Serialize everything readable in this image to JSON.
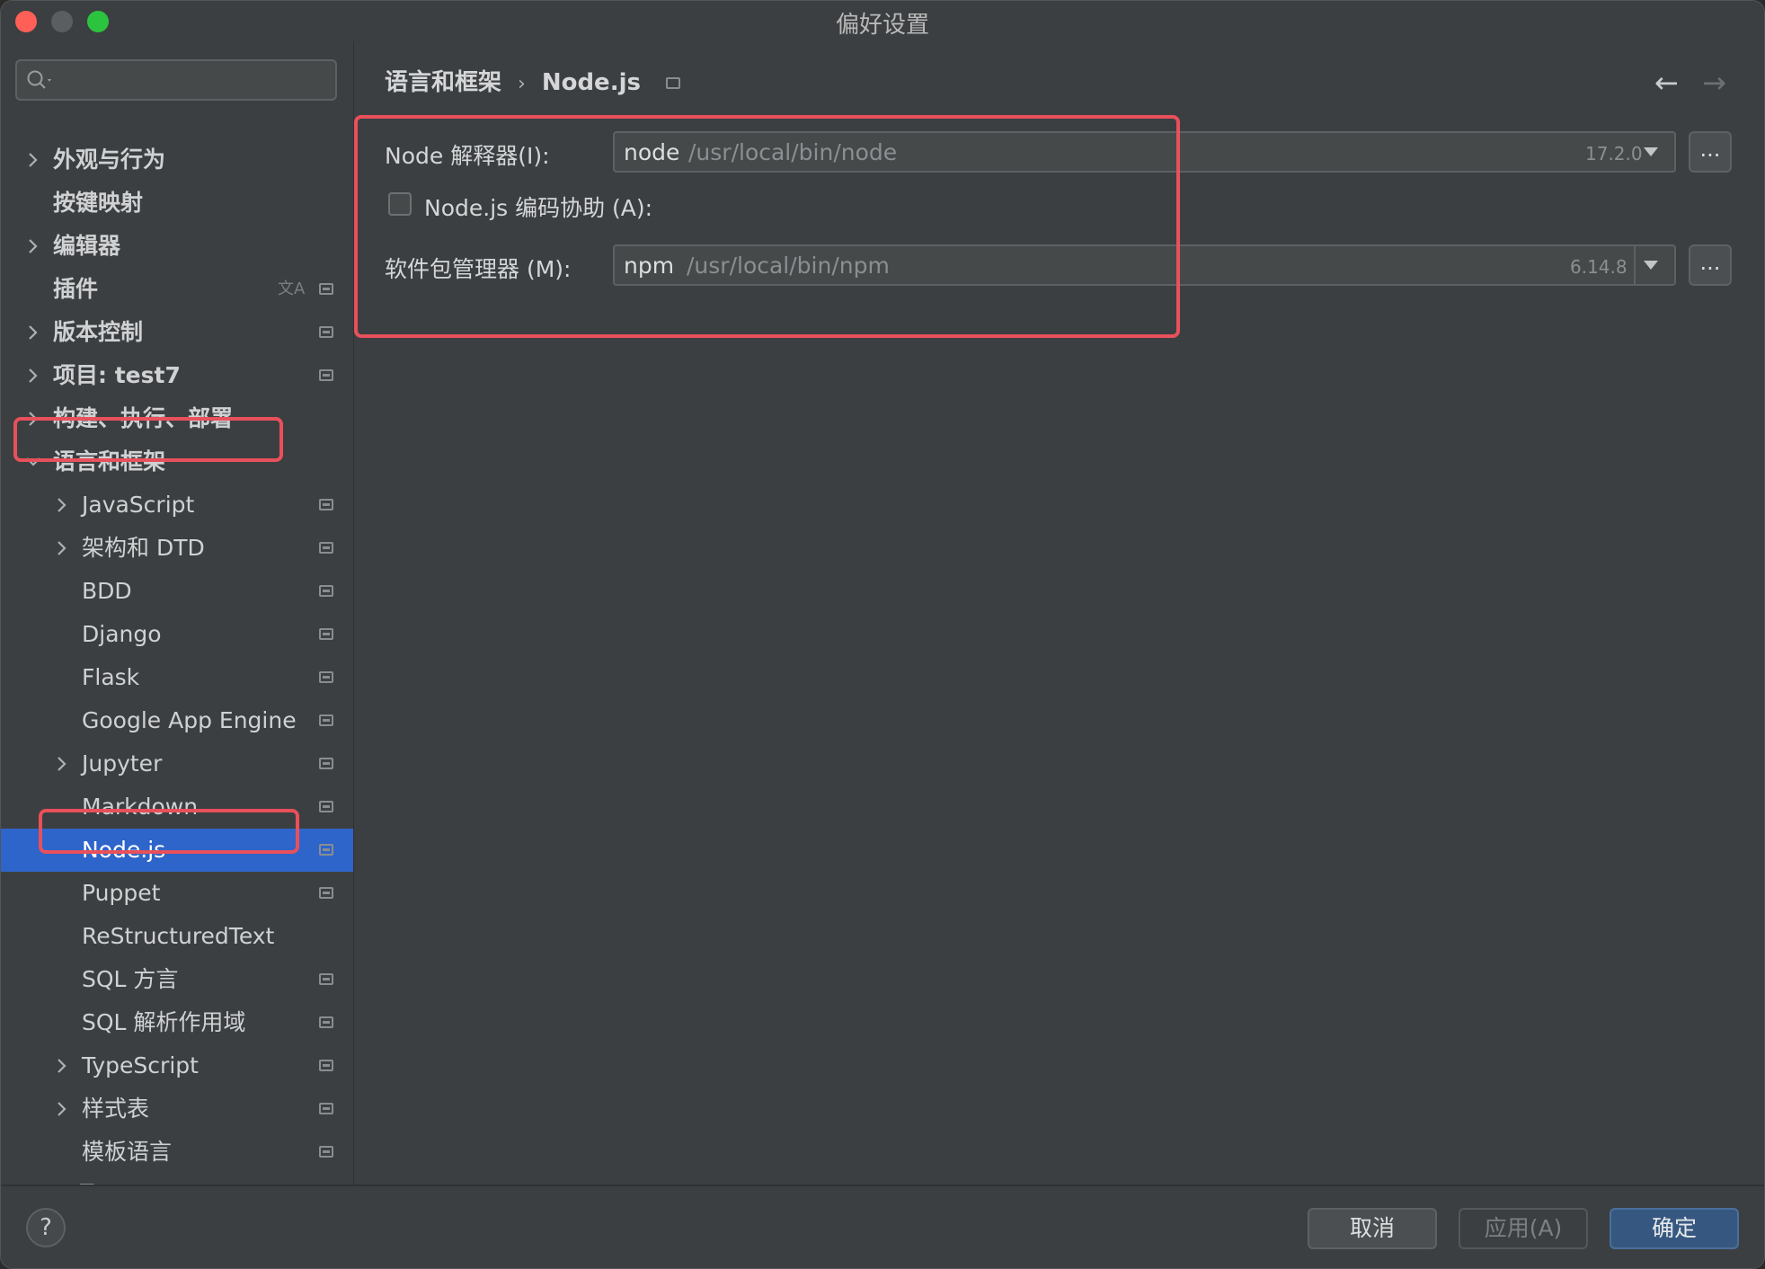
{
  "window": {
    "title": "偏好设置"
  },
  "search": {
    "placeholder": ""
  },
  "sidebar": {
    "items": [
      {
        "label": "外观与行为",
        "expandable": true,
        "expanded": false,
        "level": 0,
        "pin": false
      },
      {
        "label": "按键映射",
        "expandable": false,
        "level": 0,
        "pin": false
      },
      {
        "label": "编辑器",
        "expandable": true,
        "expanded": false,
        "level": 0,
        "pin": false
      },
      {
        "label": "插件",
        "expandable": false,
        "level": 0,
        "pin": true,
        "translate": true
      },
      {
        "label": "版本控制",
        "expandable": true,
        "expanded": false,
        "level": 0,
        "pin": true
      },
      {
        "label": "项目: test7",
        "expandable": true,
        "expanded": false,
        "level": 0,
        "pin": true
      },
      {
        "label": "构建、执行、部署",
        "expandable": true,
        "expanded": false,
        "level": 0,
        "pin": false
      },
      {
        "label": "语言和框架",
        "expandable": true,
        "expanded": true,
        "level": 0,
        "pin": false
      },
      {
        "label": "JavaScript",
        "expandable": true,
        "expanded": false,
        "level": 1,
        "pin": true
      },
      {
        "label": "架构和 DTD",
        "expandable": true,
        "expanded": false,
        "level": 1,
        "pin": true
      },
      {
        "label": "BDD",
        "expandable": false,
        "level": 1,
        "pin": true
      },
      {
        "label": "Django",
        "expandable": false,
        "level": 1,
        "pin": true
      },
      {
        "label": "Flask",
        "expandable": false,
        "level": 1,
        "pin": true
      },
      {
        "label": "Google App Engine",
        "expandable": false,
        "level": 1,
        "pin": true
      },
      {
        "label": "Jupyter",
        "expandable": true,
        "expanded": false,
        "level": 1,
        "pin": true
      },
      {
        "label": "Markdown",
        "expandable": false,
        "level": 1,
        "pin": true
      },
      {
        "label": "Node.js",
        "expandable": false,
        "level": 1,
        "pin": true,
        "selected": true
      },
      {
        "label": "Puppet",
        "expandable": false,
        "level": 1,
        "pin": true
      },
      {
        "label": "ReStructuredText",
        "expandable": false,
        "level": 1,
        "pin": false
      },
      {
        "label": "SQL 方言",
        "expandable": false,
        "level": 1,
        "pin": true
      },
      {
        "label": "SQL 解析作用域",
        "expandable": false,
        "level": 1,
        "pin": true
      },
      {
        "label": "TypeScript",
        "expandable": true,
        "expanded": false,
        "level": 1,
        "pin": true
      },
      {
        "label": "样式表",
        "expandable": true,
        "expanded": false,
        "level": 1,
        "pin": true
      },
      {
        "label": "模板语言",
        "expandable": false,
        "level": 1,
        "pin": true
      },
      {
        "label": "工具",
        "expandable": true,
        "expanded": false,
        "level": 0,
        "pin": false
      }
    ]
  },
  "breadcrumb": {
    "parent": "语言和框架",
    "separator": "›",
    "current": "Node.js"
  },
  "nav": {
    "back": "←",
    "forward": "→"
  },
  "form": {
    "interpreter_label": "Node 解释器(I):",
    "interpreter_name": "node",
    "interpreter_path": "/usr/local/bin/node",
    "interpreter_version": "17.2.0",
    "coding_assist_label": "Node.js 编码协助 (A):",
    "coding_assist_checked": false,
    "package_manager_label": "软件包管理器 (M):",
    "package_manager_name": "npm",
    "package_manager_path": "/usr/local/bin/npm",
    "package_manager_version": "6.14.8",
    "browse_label": "..."
  },
  "footer": {
    "help": "?",
    "cancel": "取消",
    "apply": "应用(A)",
    "ok": "确定"
  },
  "colors": {
    "highlight_box": "#e8505b",
    "selection": "#2e65ca",
    "primary_button": "#365880"
  }
}
